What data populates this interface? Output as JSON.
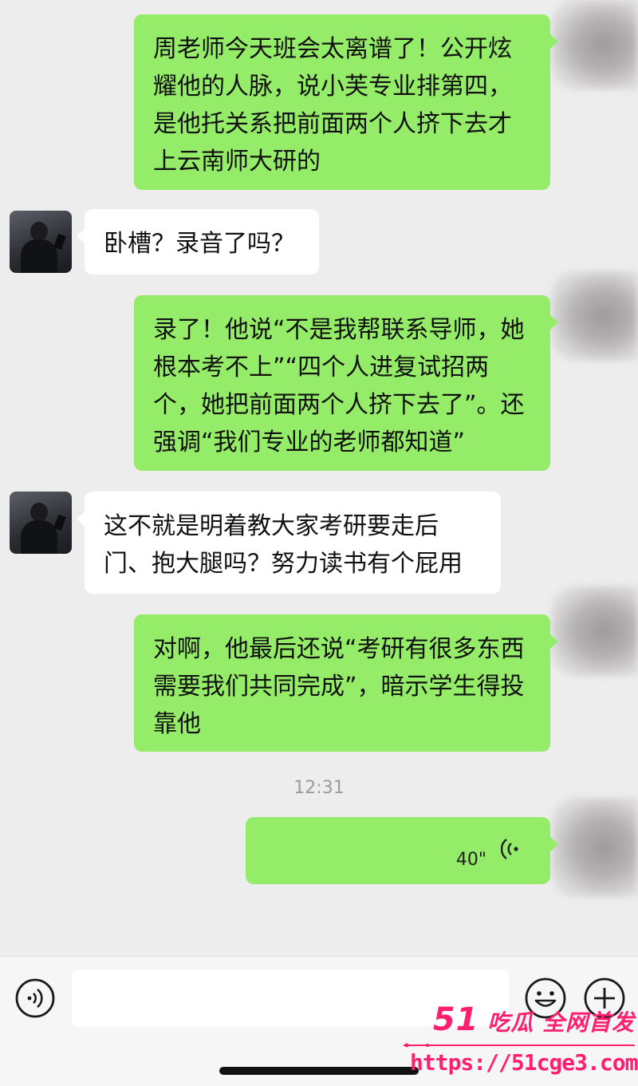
{
  "messages": [
    {
      "side": "right",
      "text": "周老师今天班会太离谱了！公开炫耀他的人脉，说小芙专业排第四，是他托关系把前面两个人挤下去才上云南师大研的"
    },
    {
      "side": "left",
      "text": "卧槽？录音了吗？"
    },
    {
      "side": "right",
      "text": "录了！他说“不是我帮联系导师，她根本考不上”“四个人进复试招两个，她把前面两个人挤下去了”。还强调“我们专业的老师都知道”"
    },
    {
      "side": "left",
      "text": "这不就是明着教大家考研要走后门、抱大腿吗？努力读书有个屁用"
    },
    {
      "side": "right",
      "text": "对啊，他最后还说“考研有很多东西需要我们共同完成”，暗示学生得投靠他"
    }
  ],
  "timestamp": "12:31",
  "voice_message": {
    "duration": "40\""
  },
  "input_bar": {
    "placeholder": ""
  },
  "icons": {
    "voice_toggle": "voice-icon",
    "emoji": "emoji-icon",
    "more": "plus-icon",
    "voice_playback": "voice-wave-icon"
  },
  "colors": {
    "mine_bubble": "#95ec69",
    "theirs_bubble": "#ffffff",
    "background": "#ededed",
    "watermark": "#ff1f6e"
  },
  "watermark": {
    "brand_number": "51",
    "brand_text": "吃瓜 全网首发",
    "url": "https://51cge3.com"
  }
}
